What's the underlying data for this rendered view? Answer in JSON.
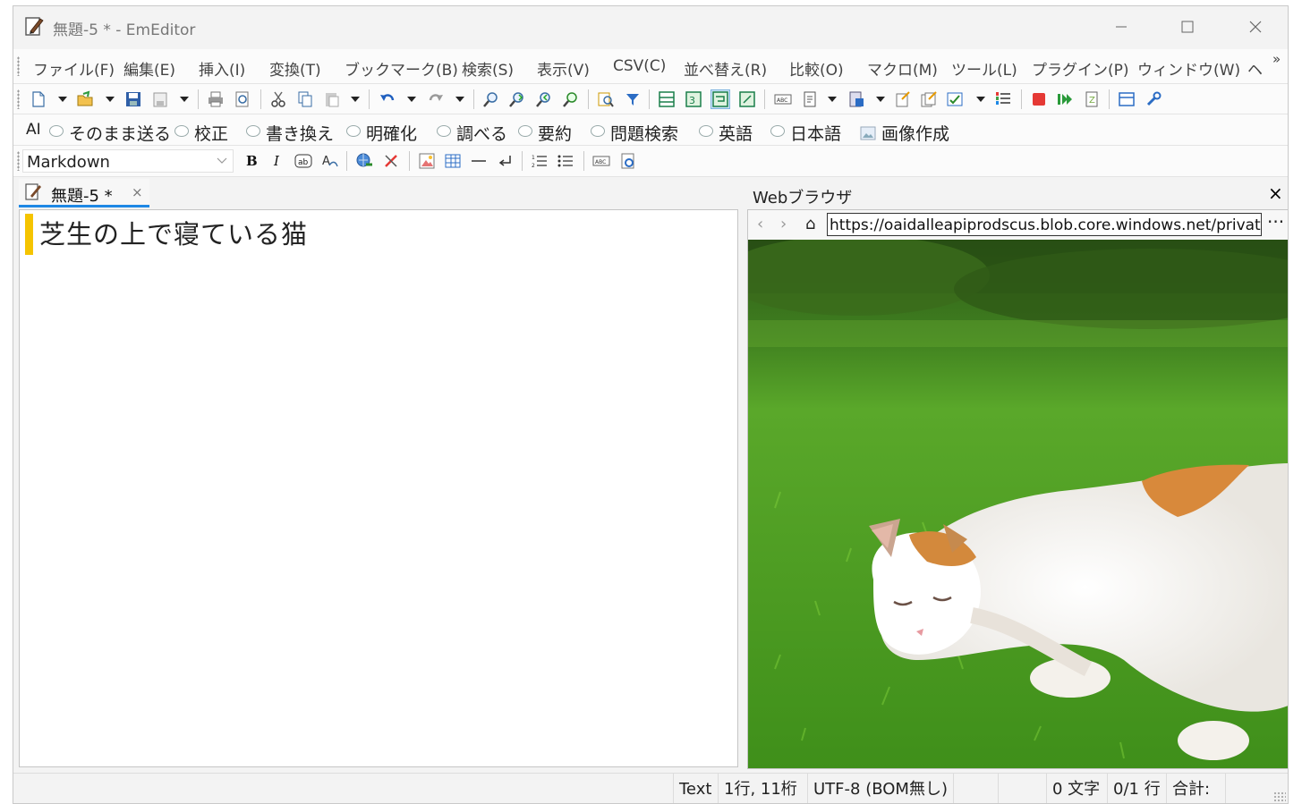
{
  "window": {
    "title": "無題-5 * - EmEditor"
  },
  "menu": [
    {
      "label": "ファイル(F)"
    },
    {
      "label": "編集(E)"
    },
    {
      "label": "挿入(I)"
    },
    {
      "label": "変換(T)"
    },
    {
      "label": "ブックマーク(B)"
    },
    {
      "label": "検索(S)"
    },
    {
      "label": "表示(V)"
    },
    {
      "label": "CSV(C)"
    },
    {
      "label": "並べ替え(R)"
    },
    {
      "label": "比較(O)"
    },
    {
      "label": "マクロ(M)"
    },
    {
      "label": "ツール(L)"
    },
    {
      "label": "プラグイン(P)"
    },
    {
      "label": "ウィンドウ(W)"
    },
    {
      "label": "ヘ"
    }
  ],
  "menu_overflow": "»",
  "ai_toolbar": {
    "label": "AI",
    "items": [
      "そのまま送る",
      "校正",
      "書き換え",
      "明確化",
      "調べる",
      "要約",
      "問題検索",
      "英語",
      "日本語",
      "画像作成"
    ]
  },
  "markdown_toolbar": {
    "format_value": "Markdown"
  },
  "doc_tab": {
    "label": "無題-5 *",
    "close": "×"
  },
  "editor": {
    "text": "芝生の上で寝ている猫"
  },
  "browser": {
    "title": "Webブラウザ",
    "close": "×",
    "back": "‹",
    "forward": "›",
    "home": "⌂",
    "url": "https://oaidalleapiprodscus.blob.core.windows.net/private/",
    "more": "···"
  },
  "status": {
    "mode": "Text",
    "position": "1行, 11桁",
    "encoding": "UTF-8 (BOM無し)",
    "chars": "0 文字",
    "lines": "0/1 行",
    "total": "合計:"
  },
  "colors": {
    "accent": "#1e88e5",
    "marker": "#f5c400",
    "record": "#e53935"
  }
}
